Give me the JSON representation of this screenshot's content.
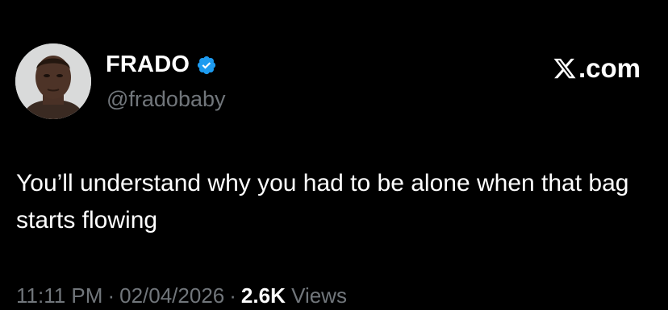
{
  "author": {
    "display_name": "FRADO",
    "handle": "@fradobaby",
    "verified": true,
    "avatar_icon": "profile-photo"
  },
  "brand": {
    "icon": "x-logo-icon",
    "text": ".com"
  },
  "tweet": {
    "text": "You’ll understand why you had to be alone when that bag starts flowing"
  },
  "meta": {
    "time": "11:11 PM",
    "date": "02/04/2026",
    "views_count": "2.6K",
    "views_label": "Views",
    "separator": "·"
  },
  "colors": {
    "background": "#000000",
    "text_primary": "#ffffff",
    "text_secondary": "#71767b",
    "verified_badge": "#1d9bf0"
  }
}
